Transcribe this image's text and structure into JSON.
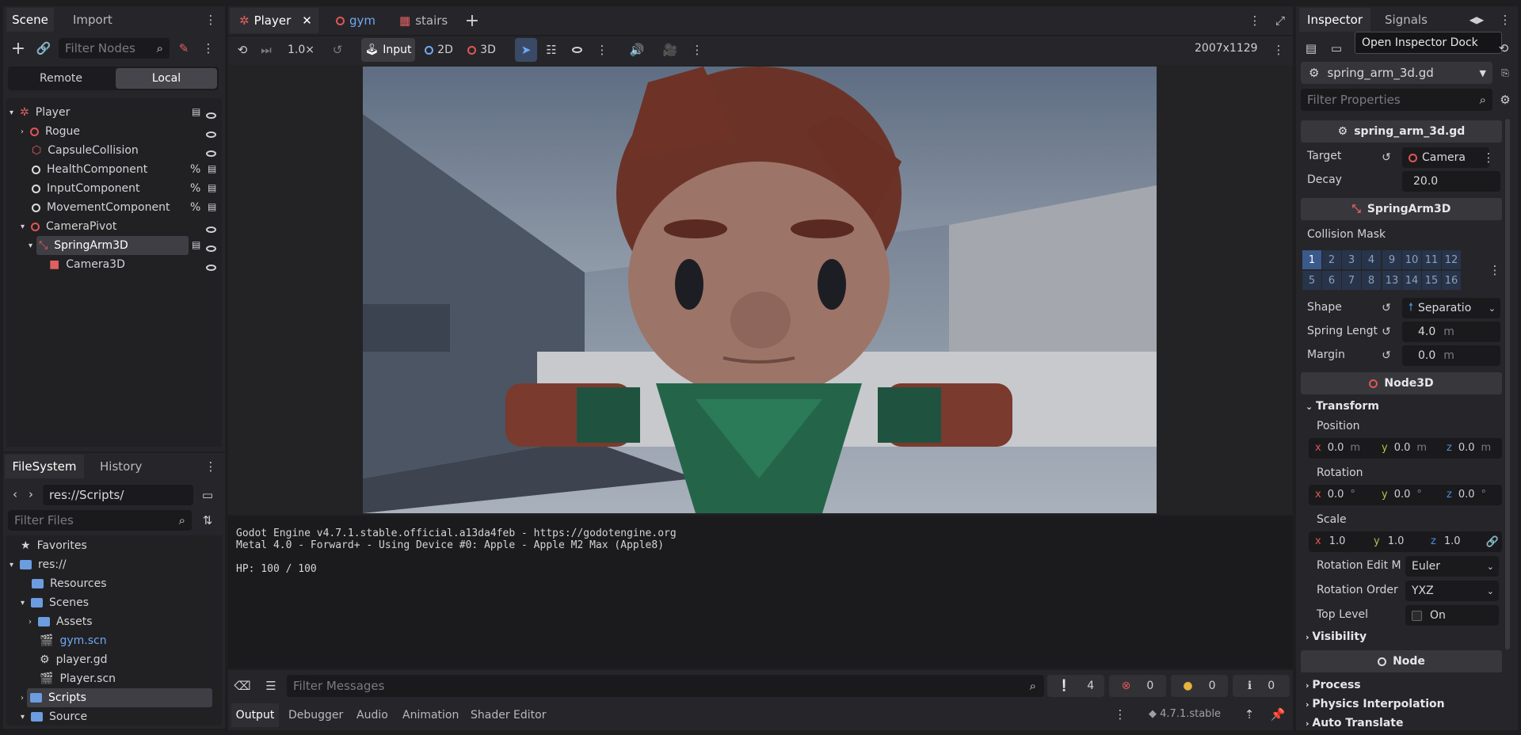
{
  "scene_dock": {
    "tabs": [
      "Scene",
      "Import"
    ],
    "filter_placeholder": "Filter Nodes",
    "remote_label": "Remote",
    "local_label": "Local",
    "nodes": [
      {
        "label": "Player"
      },
      {
        "label": "Rogue"
      },
      {
        "label": "CapsuleCollision"
      },
      {
        "label": "HealthComponent"
      },
      {
        "label": "InputComponent"
      },
      {
        "label": "MovementComponent"
      },
      {
        "label": "CameraPivot"
      },
      {
        "label": "SpringArm3D"
      },
      {
        "label": "Camera3D"
      }
    ]
  },
  "filesystem_dock": {
    "tabs": [
      "FileSystem",
      "History"
    ],
    "path": "res://Scripts/",
    "filter_placeholder": "Filter Files",
    "items": [
      {
        "label": "Favorites"
      },
      {
        "label": "res://"
      },
      {
        "label": "Resources"
      },
      {
        "label": "Scenes"
      },
      {
        "label": "Assets"
      },
      {
        "label": "gym.scn"
      },
      {
        "label": "player.gd"
      },
      {
        "label": "Player.scn"
      },
      {
        "label": "Scripts"
      },
      {
        "label": "Source"
      }
    ]
  },
  "editor_tabs": [
    "Player",
    "gym",
    "stairs"
  ],
  "toolbar": {
    "speed": "1.0×",
    "input_label": "Input",
    "mode_2d": "2D",
    "mode_3d": "3D",
    "resolution": "2007x1129"
  },
  "output": {
    "lines": [
      "Godot Engine v4.7.1.stable.official.a13da4feb - https://godotengine.org",
      "Metal 4.0 - Forward+ - Using Device #0: Apple - Apple M2 Max (Apple8)",
      "",
      "HP: 100 / 100"
    ],
    "filter_placeholder": "Filter Messages",
    "counts": {
      "messages": "4",
      "errors": "0",
      "warnings": "0",
      "info": "0"
    }
  },
  "bottom_tabs": [
    "Output",
    "Debugger",
    "Audio",
    "Animation",
    "Shader Editor"
  ],
  "version": "4.7.1.stable",
  "inspector": {
    "tabs": [
      "Inspector",
      "Signals"
    ],
    "tooltip": "Open Inspector Dock",
    "resource": "spring_arm_3d.gd",
    "filter_placeholder": "Filter Properties",
    "script_section": "spring_arm_3d.gd",
    "target_label": "Target",
    "target_value": "Camera",
    "decay_label": "Decay",
    "decay_value": "20.0",
    "springarm_section": "SpringArm3D",
    "collision_mask_label": "Collision Mask",
    "mask_row1": [
      "1",
      "2",
      "3",
      "4",
      "9",
      "10",
      "11",
      "12"
    ],
    "mask_row2": [
      "5",
      "6",
      "7",
      "8",
      "13",
      "14",
      "15",
      "16"
    ],
    "shape_label": "Shape",
    "shape_value": "Separatio",
    "spring_length_label": "Spring Lengt",
    "spring_length_value": "4.0",
    "unit_m": "m",
    "margin_label": "Margin",
    "margin_value": "0.0",
    "node3d_section": "Node3D",
    "transform_label": "Transform",
    "position_label": "Position",
    "position": {
      "x": "0.0",
      "y": "0.0",
      "z": "0.0"
    },
    "rotation_label": "Rotation",
    "rotation": {
      "x": "0.0",
      "y": "0.0",
      "z": "0.0"
    },
    "deg": "°",
    "scale_label": "Scale",
    "scale": {
      "x": "1.0",
      "y": "1.0",
      "z": "1.0"
    },
    "rot_edit_label": "Rotation Edit M",
    "rot_edit_value": "Euler",
    "rot_order_label": "Rotation Order",
    "rot_order_value": "YXZ",
    "top_level_label": "Top Level",
    "top_level_value": "On",
    "visibility_label": "Visibility",
    "node_section": "Node",
    "process_label": "Process",
    "physics_interp_label": "Physics Interpolation",
    "auto_translate_label": "Auto Translate"
  },
  "colors": {
    "accent": "#4b8ee0",
    "error": "#e05555",
    "warning": "#e6b43c"
  }
}
